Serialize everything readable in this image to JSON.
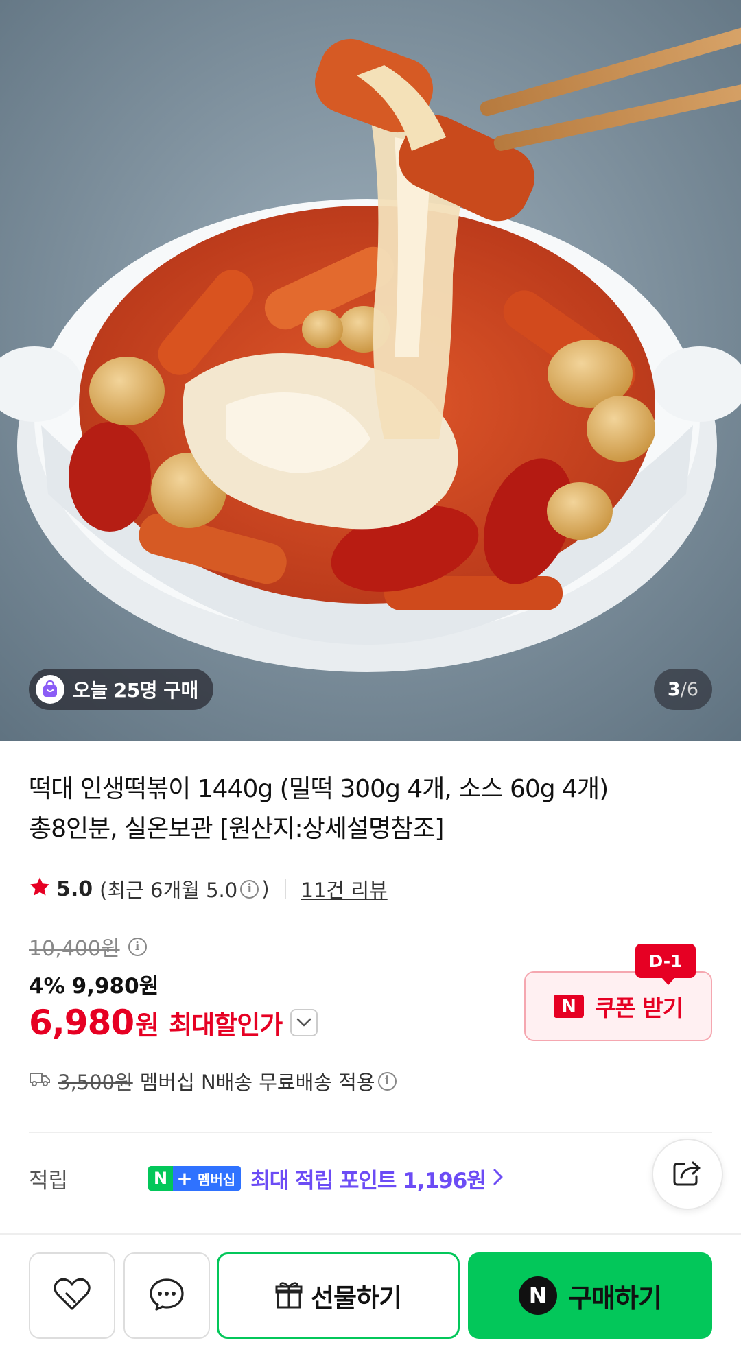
{
  "hero": {
    "today_badge": "오늘 25명 구매",
    "page_current": "3",
    "page_sep": "/",
    "page_total": "6"
  },
  "product": {
    "title_line1": "떡대 인생떡볶이 1440g (밀떡 300g 4개, 소스 60g 4개)",
    "title_line2": "총8인분, 실온보관 [원산지:상세설명참조]"
  },
  "rating": {
    "score": "5.0",
    "recent_prefix": "(최근 6개월 5.0",
    "recent_suffix": ")",
    "reviews": "11건 리뷰"
  },
  "price": {
    "original": "10,400원",
    "discount_pct": "4%",
    "discount_price": "9,980원",
    "final_value": "6,980",
    "final_won": "원",
    "final_label": "최대할인가"
  },
  "coupon": {
    "badge": "D-1",
    "logo": "N",
    "label": "쿠폰 받기"
  },
  "shipping": {
    "old_fee": "3,500원",
    "note": "멤버십 N배송 무료배송 적용"
  },
  "points": {
    "label": "적립",
    "badge_n": "N",
    "badge_plus": "+",
    "badge_text": "멤버십",
    "max_text": "최대 적립 포인트 1,196원"
  },
  "bottom_bar": {
    "gift_label": "선물하기",
    "buy_logo": "N",
    "buy_label": "구매하기"
  },
  "colors": {
    "accent_red": "#e60023",
    "naver_green": "#03c75a",
    "points_purple": "#6c4cf5",
    "member_blue": "#2f72ff"
  },
  "icons": [
    "shopping-bag-icon",
    "star-icon",
    "info-icon",
    "chevron-down-icon",
    "truck-icon",
    "chevron-right-icon",
    "share-icon",
    "heart-icon",
    "chat-icon",
    "gift-icon"
  ]
}
